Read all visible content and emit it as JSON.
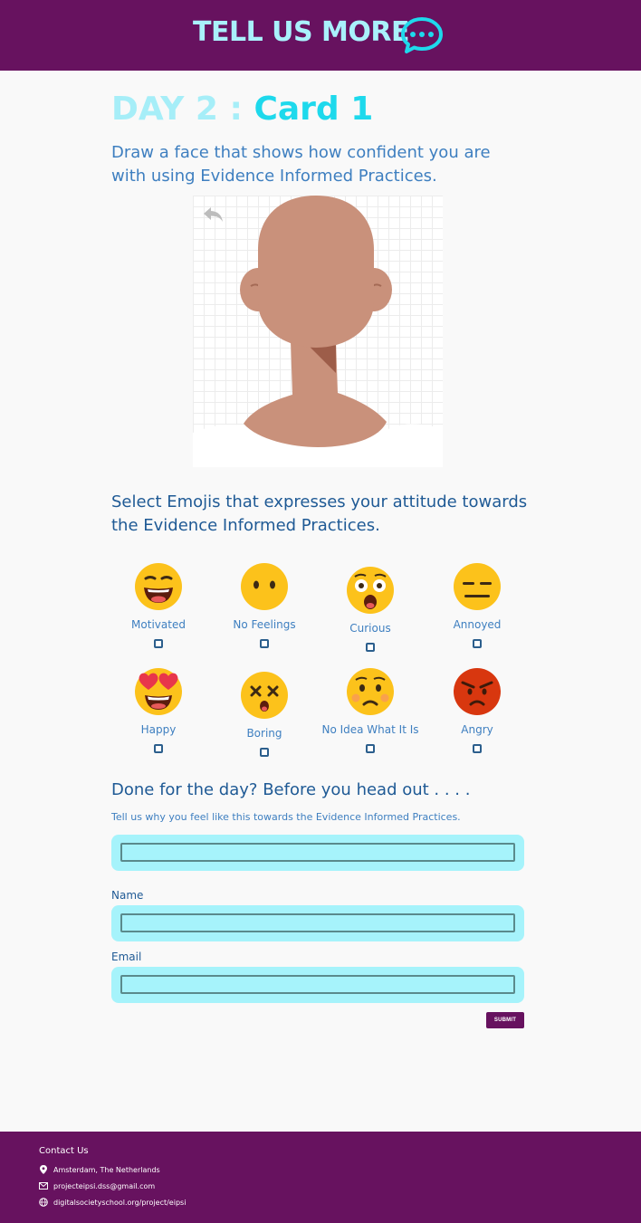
{
  "header": {
    "title": "TELL US MORE"
  },
  "card": {
    "day": "DAY 2 :",
    "card_label": "Card 1",
    "prompt": "Draw a face that shows how confident you are with using Evidence Informed Practices."
  },
  "emojis": {
    "prompt": "Select Emojis that expresses your attitude towards the Evidence Informed Practices.",
    "items": [
      {
        "label": "Motivated",
        "icon": "grinning-face-icon"
      },
      {
        "label": "No Feelings",
        "icon": "face-without-mouth-icon"
      },
      {
        "label": "Curious",
        "icon": "astonished-face-icon"
      },
      {
        "label": "Annoyed",
        "icon": "expressionless-face-icon"
      },
      {
        "label": "Happy",
        "icon": "heart-eyes-face-icon"
      },
      {
        "label": "Boring",
        "icon": "dizzy-face-icon"
      },
      {
        "label": "No Idea What It Is",
        "icon": "confused-face-icon"
      },
      {
        "label": "Angry",
        "icon": "angry-face-icon"
      }
    ]
  },
  "form": {
    "heading": "Done for the day? Before you head out . . . .",
    "why_label": "Tell us why you feel like this towards the Evidence Informed Practices.",
    "why_value": "",
    "name_label": "Name",
    "name_value": "",
    "email_label": "Email",
    "email_value": "",
    "submit_label": "SUBMIT"
  },
  "footer": {
    "title": "Contact Us",
    "address": "Amsterdam, The Netherlands",
    "email": "projecteipsi.dss@gmail.com",
    "website": "digitalsocietyschool.org/project/eipsi"
  },
  "colors": {
    "brand_purple": "#67125f",
    "accent_cyan": "#1ed9ec",
    "input_fill": "#a6f3fb",
    "text_blue": "#3e7fc0"
  }
}
